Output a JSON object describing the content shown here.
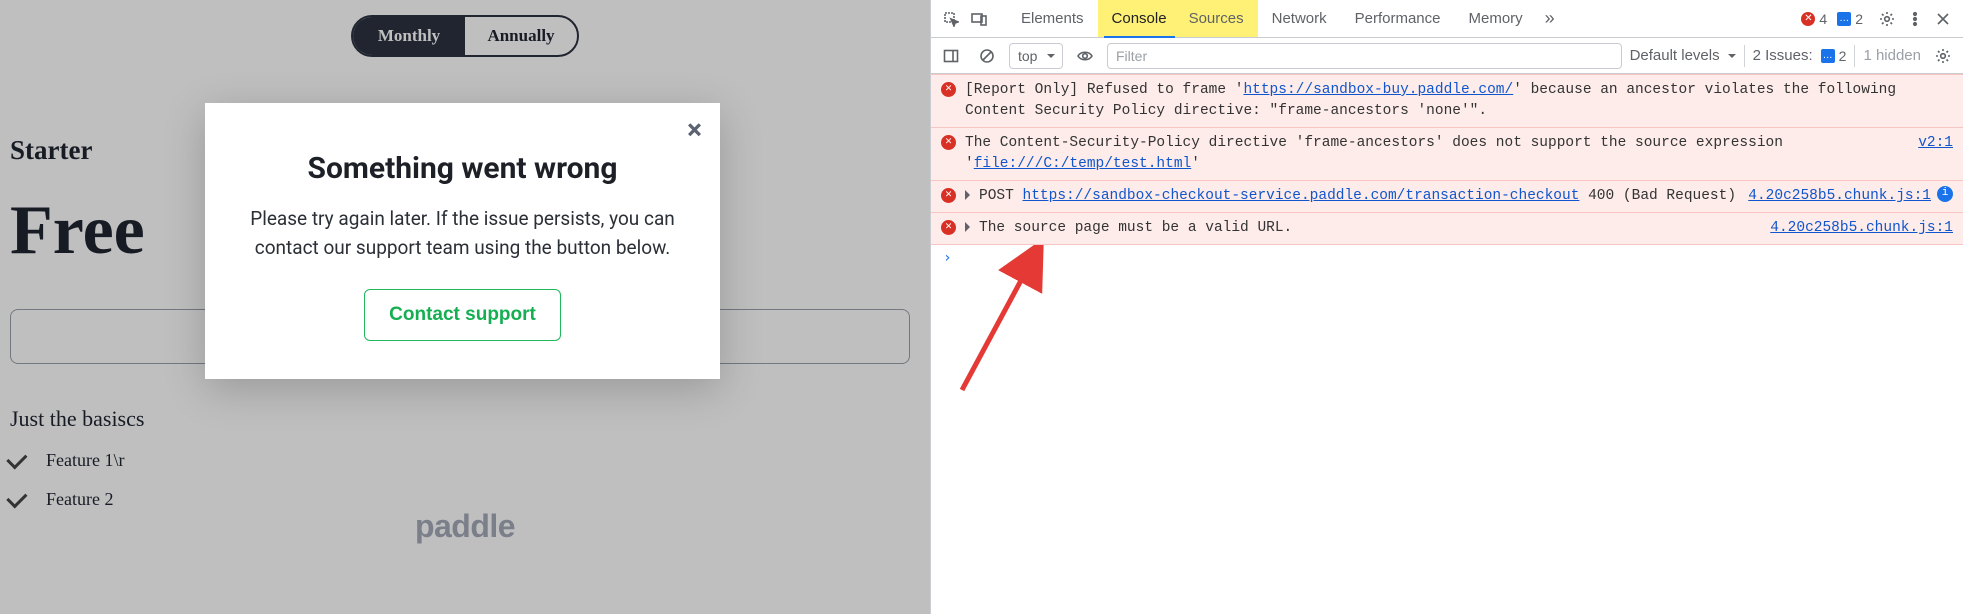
{
  "page": {
    "toggle": {
      "monthly": "Monthly",
      "annually": "Annually"
    },
    "plan": {
      "name": "Starter",
      "price": "Free",
      "subheading": "Just the basiscs"
    },
    "features": [
      "Feature 1\\r",
      "Feature 2"
    ],
    "logo": "paddle"
  },
  "modal": {
    "title": "Something went wrong",
    "body": "Please try again later. If the issue persists, you can contact our support team using the button below.",
    "button": "Contact support",
    "close": "×"
  },
  "devtools": {
    "tabs": [
      "Elements",
      "Console",
      "Sources",
      "Network",
      "Performance",
      "Memory"
    ],
    "active_tab": "Console",
    "more_glyph": "»",
    "error_count": "4",
    "info_count": "2",
    "toolbar": {
      "context": "top",
      "filter_placeholder": "Filter",
      "levels": "Default levels",
      "issues_label": "2 Issues:",
      "issues_count": "2",
      "hidden": "1 hidden"
    },
    "log": [
      {
        "type": "error",
        "text_pre": "[Report Only] Refused to frame '",
        "url": "https://sandbox-buy.paddle.com/",
        "text_post": "' because an ancestor violates the following Content Security Policy directive: \"frame-ancestors 'none'\".",
        "src": ""
      },
      {
        "type": "error",
        "text_pre": "The Content-Security-Policy directive 'frame-ancestors' does not support the source expression '",
        "url": "file:///C:/temp/test.html",
        "text_post": "'",
        "src": "v2:1"
      },
      {
        "type": "error",
        "expandable": true,
        "method": "POST",
        "url": "https://sandbox-checkout-service.paddle.com/transaction-checkout",
        "text_post": " 400 (Bad Request)",
        "src": "4.20c258b5.chunk.js:1",
        "info_badge": true
      },
      {
        "type": "error",
        "expandable": true,
        "text_pre": "The source page must be a valid URL.",
        "src": "4.20c258b5.chunk.js:1"
      }
    ]
  }
}
